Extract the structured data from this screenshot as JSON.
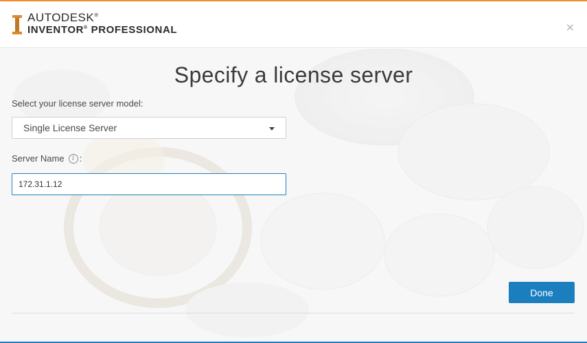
{
  "app": {
    "brand_top": "AUTODESK",
    "brand_bottom": "INVENTOR",
    "brand_suffix": "PROFESSIONAL",
    "reg_mark": "®",
    "close_glyph": "×",
    "accent_color": "#f28c28",
    "primary_color": "#1b7fbf"
  },
  "main": {
    "title": "Specify a license server",
    "model_label": "Select your license server model:",
    "model_select": {
      "selected": "Single License Server"
    },
    "server_label": "Server Name",
    "server_colon": ":",
    "server_input": {
      "value": "172.31.1.12"
    },
    "info_glyph": "i",
    "done_label": "Done"
  }
}
